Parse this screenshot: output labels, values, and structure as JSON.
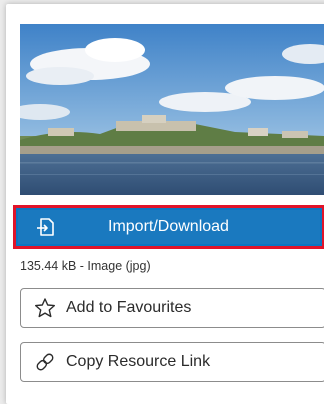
{
  "resource": {
    "import_label": "Import/Download",
    "meta": "135.44 kB - Image (jpg)",
    "favourites_label": "Add to Favourites",
    "copy_link_label": "Copy Resource Link"
  },
  "icons": {
    "import": "import-icon",
    "favourite": "star-outline-icon",
    "copy_link": "link-icon"
  },
  "colors": {
    "primary_button": "#1a79bf",
    "highlight_border": "#e0142a"
  }
}
